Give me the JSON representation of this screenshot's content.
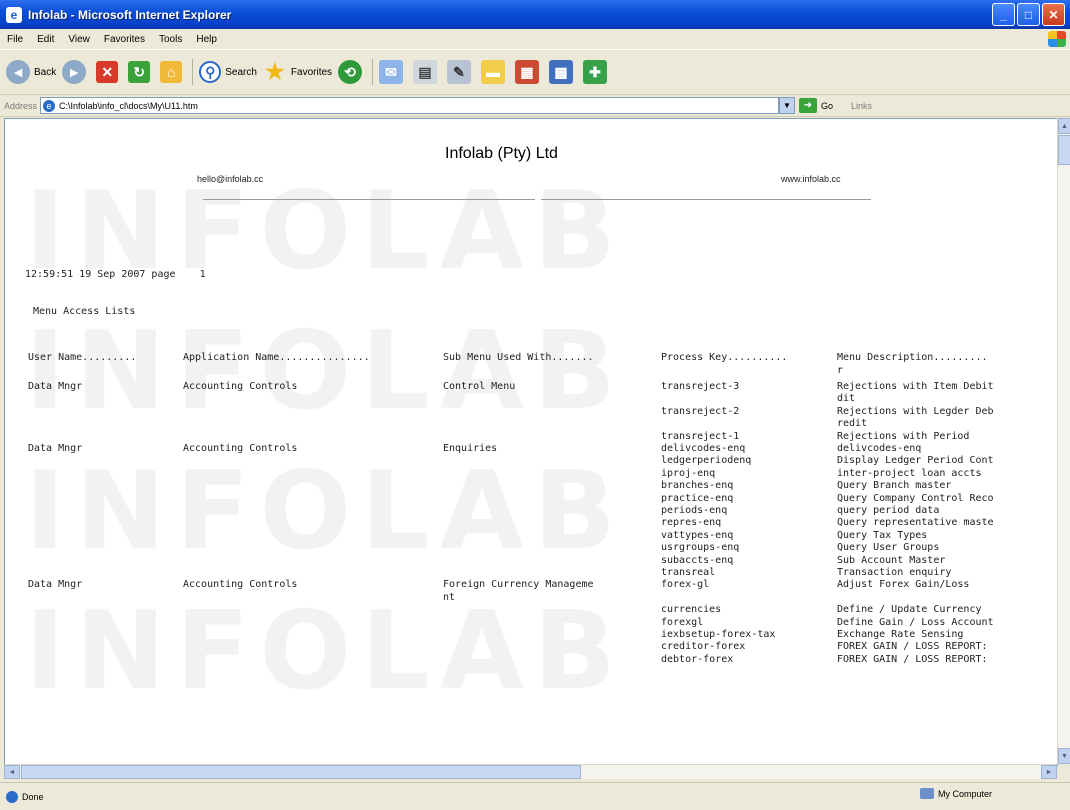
{
  "window": {
    "title": "Infolab - Microsoft Internet Explorer",
    "controls": {
      "minimize": "_",
      "maximize": "□",
      "close": "✕"
    }
  },
  "menubar": [
    "File",
    "Edit",
    "View",
    "Favorites",
    "Tools",
    "Help"
  ],
  "toolbar": {
    "back_label": "Back",
    "search_label": "Search",
    "favorites_label": "Favorites"
  },
  "addressbar": {
    "label": "Address",
    "url": "C:\\Infolab\\info_cl\\docs\\My\\U11.htm",
    "go_label": "Go",
    "links_label": "Links"
  },
  "report": {
    "company": "Infolab (Pty) Ltd",
    "email": "hello@infolab.cc",
    "website": "www.infolab.cc",
    "timestamp_page": "12:59:51 19 Sep 2007 page    1",
    "title": "Menu Access Lists",
    "headers": {
      "user": "User Name.........",
      "app": "Application Name...............",
      "sub": "Sub Menu Used With.......",
      "key": "Process Key..........",
      "desc": "Menu Description........."
    },
    "desc_wrap": "r",
    "rows": [
      {
        "user": "Data Mngr",
        "app": "Accounting Controls",
        "sub": "Control Menu",
        "key": "transreject-3",
        "desc": "Rejections with Item Debit"
      },
      {
        "user": "",
        "app": "",
        "sub": "",
        "key": "",
        "desc": "dit"
      },
      {
        "user": "",
        "app": "",
        "sub": "",
        "key": "transreject-2",
        "desc": "Rejections with Legder Deb"
      },
      {
        "user": "",
        "app": "",
        "sub": "",
        "key": "",
        "desc": "redit"
      },
      {
        "user": "",
        "app": "",
        "sub": "",
        "key": "transreject-1",
        "desc": "Rejections with Period"
      },
      {
        "user": "Data Mngr",
        "app": "Accounting Controls",
        "sub": "Enquiries",
        "key": "delivcodes-enq",
        "desc": "delivcodes-enq"
      },
      {
        "user": "",
        "app": "",
        "sub": "",
        "key": "ledgerperiodenq",
        "desc": "Display Ledger Period Cont"
      },
      {
        "user": "",
        "app": "",
        "sub": "",
        "key": "iproj-enq",
        "desc": "inter-project loan accts"
      },
      {
        "user": "",
        "app": "",
        "sub": "",
        "key": "branches-enq",
        "desc": "Query Branch master"
      },
      {
        "user": "",
        "app": "",
        "sub": "",
        "key": "practice-enq",
        "desc": "Query Company Control Reco"
      },
      {
        "user": "",
        "app": "",
        "sub": "",
        "key": "periods-enq",
        "desc": "query period data"
      },
      {
        "user": "",
        "app": "",
        "sub": "",
        "key": "repres-enq",
        "desc": "Query representative maste"
      },
      {
        "user": "",
        "app": "",
        "sub": "",
        "key": "vattypes-enq",
        "desc": "Query Tax Types"
      },
      {
        "user": "",
        "app": "",
        "sub": "",
        "key": "usrgroups-enq",
        "desc": "Query User Groups"
      },
      {
        "user": "",
        "app": "",
        "sub": "",
        "key": "subaccts-enq",
        "desc": "Sub Account Master"
      },
      {
        "user": "",
        "app": "",
        "sub": "",
        "key": "transreal",
        "desc": "Transaction enquiry"
      },
      {
        "user": "Data Mngr",
        "app": "Accounting Controls",
        "sub": "Foreign Currency Manageme",
        "key": "forex-gl",
        "desc": "Adjust Forex Gain/Loss"
      },
      {
        "user": "",
        "app": "",
        "sub": "nt",
        "key": "",
        "desc": ""
      },
      {
        "user": "",
        "app": "",
        "sub": "",
        "key": "currencies",
        "desc": "Define / Update Currency"
      },
      {
        "user": "",
        "app": "",
        "sub": "",
        "key": "forexgl",
        "desc": "Define Gain / Loss Account"
      },
      {
        "user": "",
        "app": "",
        "sub": "",
        "key": "iexbsetup-forex-tax",
        "desc": "Exchange Rate Sensing"
      },
      {
        "user": "",
        "app": "",
        "sub": "",
        "key": "creditor-forex",
        "desc": "FOREX GAIN / LOSS REPORT:"
      },
      {
        "user": "",
        "app": "",
        "sub": "",
        "key": "debtor-forex",
        "desc": "FOREX GAIN / LOSS REPORT:"
      }
    ]
  },
  "watermark": "INFOLAB",
  "statusbar": {
    "status": "Done",
    "zone": "My Computer"
  }
}
